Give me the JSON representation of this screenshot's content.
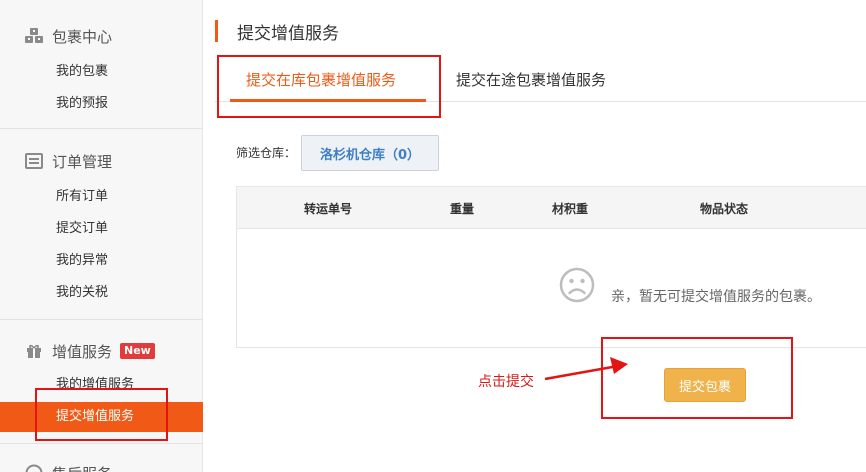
{
  "sidebar": {
    "sections": [
      {
        "title": "包裹中心",
        "icon": "boxes-icon",
        "items": [
          "我的包裹",
          "我的预报"
        ]
      },
      {
        "title": "订单管理",
        "icon": "list-icon",
        "items": [
          "所有订单",
          "提交订单",
          "我的异常",
          "我的关税"
        ]
      },
      {
        "title": "增值服务",
        "icon": "gift-icon",
        "badge": "New",
        "items": [
          "我的增值服务",
          "提交增值服务"
        ]
      },
      {
        "title": "售后服务",
        "icon": "help-icon",
        "items": []
      }
    ]
  },
  "main": {
    "title": "提交增值服务",
    "tabs": [
      "提交在库包裹增值服务",
      "提交在途包裹增值服务"
    ],
    "active_tab": 0,
    "filter": {
      "label": "筛选仓库：",
      "warehouse": "洛杉机仓库（0）"
    },
    "table": {
      "columns": [
        "转运单号",
        "重量",
        "材积重",
        "物品状态"
      ],
      "empty_message": "亲，暂无可提交增值服务的包裹。",
      "empty_icon": "sad-face-icon"
    },
    "submit_label": "提交包裹"
  },
  "annotation": {
    "text": "点击提交",
    "color": "#e31414"
  },
  "colors": {
    "accent": "#f05a16",
    "button": "#f0b24a",
    "link": "#3e7fc6"
  }
}
